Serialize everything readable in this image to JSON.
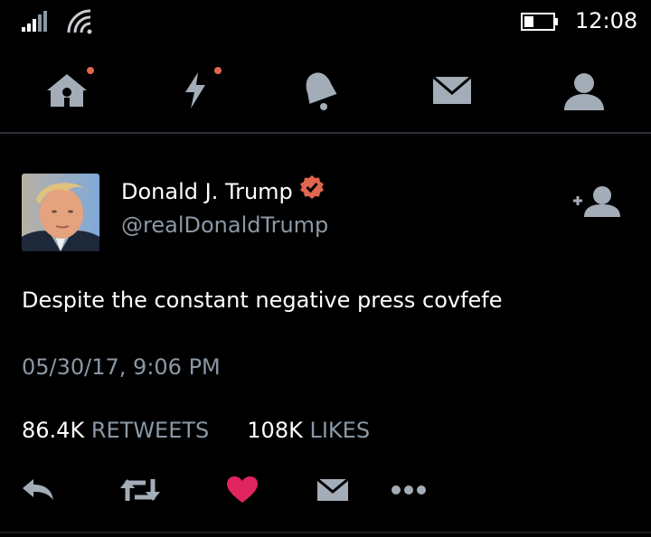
{
  "status_bar": {
    "time": "12:08"
  },
  "nav": {
    "items": [
      {
        "icon": "home-icon",
        "has_notification": true
      },
      {
        "icon": "lightning-icon",
        "has_notification": true
      },
      {
        "icon": "bell-icon",
        "has_notification": false
      },
      {
        "icon": "mail-icon",
        "has_notification": false
      },
      {
        "icon": "profile-icon",
        "has_notification": false
      }
    ]
  },
  "tweet": {
    "author_name": "Donald J. Trump",
    "handle": "@realDonaldTrump",
    "verified": true,
    "text": "Despite the constant negative press covfefe",
    "timestamp": "05/30/17, 9:06 PM",
    "retweets_count": "86.4K",
    "retweets_label": "RETWEETS",
    "likes_count": "108K",
    "likes_label": "LIKES",
    "liked": true
  },
  "colors": {
    "background": "#000000",
    "secondary_text": "#8b98a5",
    "icon": "#8b98a5",
    "notification_dot": "#e0674f",
    "verified": "#e0674f",
    "like": "#e0245e"
  }
}
